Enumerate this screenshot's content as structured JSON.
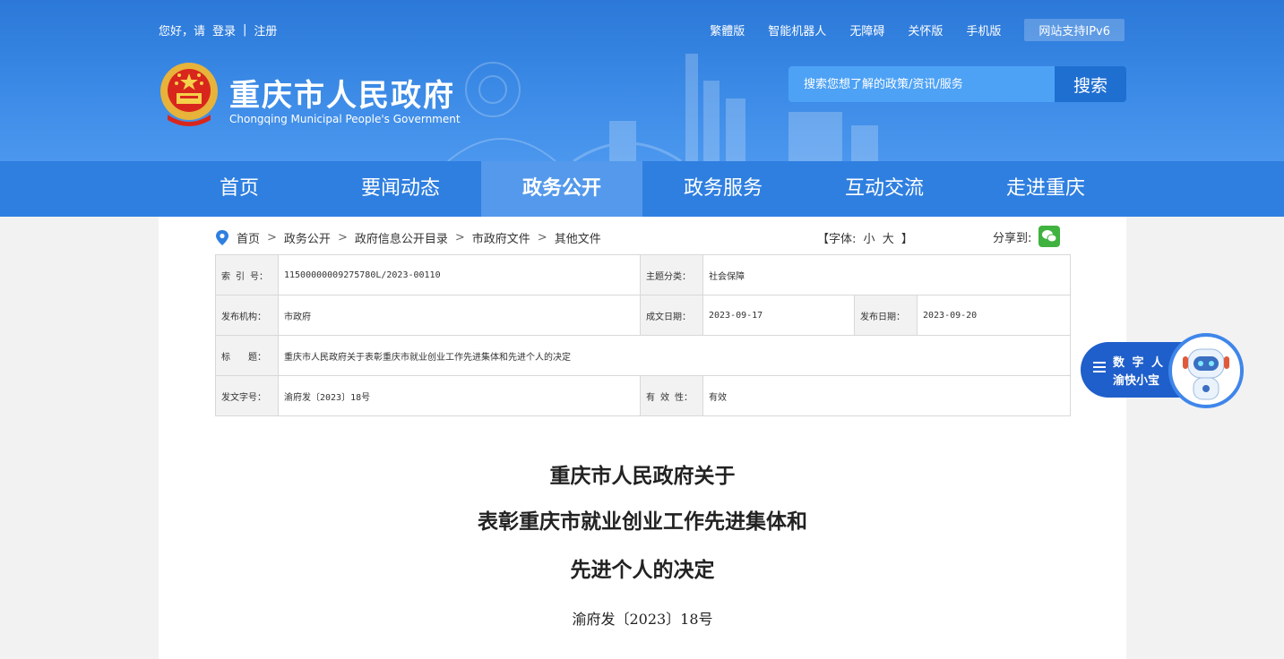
{
  "topbar": {
    "greeting": "您好，请",
    "login": "登录",
    "divider": "|",
    "register": "注册",
    "links": [
      "繁體版",
      "智能机器人",
      "无障碍",
      "关怀版",
      "手机版"
    ],
    "ipv6": "网站支持IPv6"
  },
  "site": {
    "title": "重庆市人民政府",
    "subtitle": "Chongqing Municipal People's Government"
  },
  "search": {
    "placeholder": "搜索您想了解的政策/资讯/服务",
    "button": "搜索"
  },
  "nav": {
    "items": [
      "首页",
      "要闻动态",
      "政务公开",
      "政务服务",
      "互动交流",
      "走进重庆"
    ],
    "active": "政务公开"
  },
  "breadcrumb": {
    "items": [
      "首页",
      "政务公开",
      "政府信息公开目录",
      "市政府文件",
      "其他文件"
    ],
    "separator": ">"
  },
  "fontsize": {
    "open": "【字体:",
    "small": "小",
    "large": "大",
    "close": "】"
  },
  "share": {
    "label": "分享到:"
  },
  "meta": {
    "index_label": "索 引 号：",
    "index_value": "11500000009275780L/2023-00110",
    "topic_label": "主题分类：",
    "topic_value": "社会保障",
    "issuer_label": "发布机构：",
    "issuer_value": "市政府",
    "written_label": "成文日期：",
    "written_value": "2023-09-17",
    "published_label": "发布日期：",
    "published_value": "2023-09-20",
    "title_label": "标　　题：",
    "title_value": "重庆市人民政府关于表彰重庆市就业创业工作先进集体和先进个人的决定",
    "docno_label": "发文字号：",
    "docno_value": "渝府发〔2023〕18号",
    "validity_label": "有 效 性：",
    "validity_value": "有效"
  },
  "document": {
    "title_lines": [
      "重庆市人民政府关于",
      "表彰重庆市就业创业工作先进集体和",
      "先进个人的决定"
    ],
    "doc_number": "渝府发〔2023〕18号"
  },
  "assistant": {
    "line1": "数 字 人",
    "line2": "渝快小宝"
  },
  "colors": {
    "header": "#2b78d8",
    "nav": "#2f7fe0",
    "nav_active": "#5499eb",
    "search_button": "#1f6fd1",
    "assistant": "#1f5fcb",
    "wechat": "#3fb23f"
  }
}
